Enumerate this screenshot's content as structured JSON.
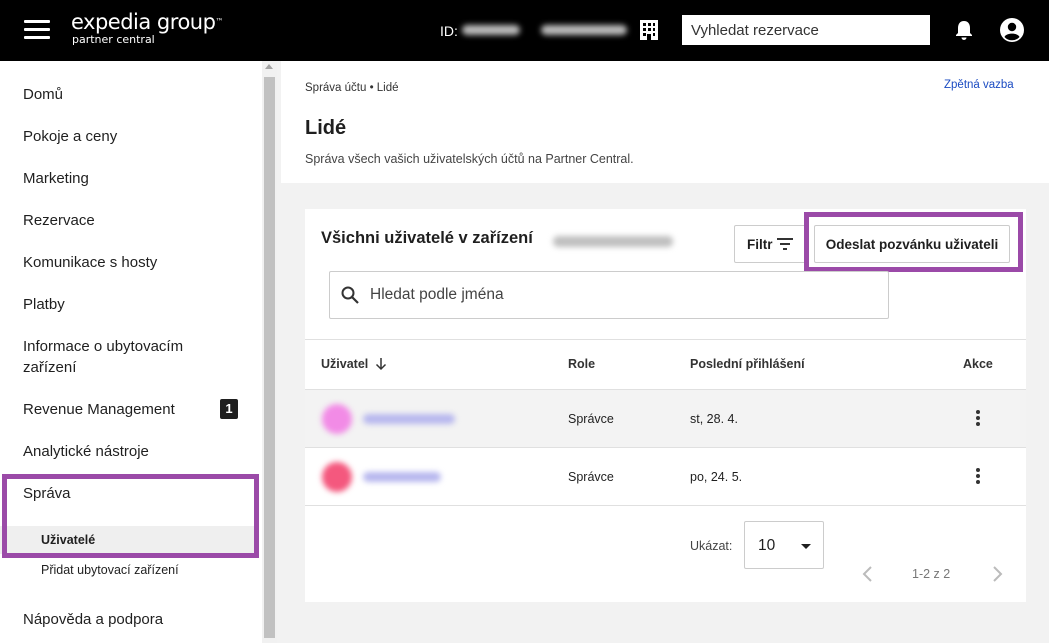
{
  "topbar": {
    "brand": "expedia group",
    "brand_tm": "™",
    "brand_sub": "partner central",
    "id_label": "ID:",
    "search_placeholder": "Vyhledat rezervace"
  },
  "sidebar": {
    "items": [
      {
        "label": "Domů"
      },
      {
        "label": "Pokoje a ceny"
      },
      {
        "label": "Marketing"
      },
      {
        "label": "Rezervace"
      },
      {
        "label": "Komunikace s hosty"
      },
      {
        "label": "Platby"
      },
      {
        "label": "Informace o ubytovacím zařízení"
      },
      {
        "label": "Revenue Management",
        "badge": "1"
      },
      {
        "label": "Analytické nástroje"
      },
      {
        "label": "Správa"
      },
      {
        "label": "Nápověda a podpora"
      }
    ],
    "sub_items": [
      {
        "label": "Uživatelé",
        "active": true
      },
      {
        "label": "Přidat ubytovací zařízení"
      }
    ]
  },
  "header": {
    "breadcrumb": "Správa účtu • Lidé",
    "feedback": "Zpětná vazba",
    "title": "Lidé",
    "description": "Správa všech vašich uživatelských účtů na Partner Central."
  },
  "card": {
    "title": "Všichni uživatelé v zařízení",
    "filter_label": "Filtr",
    "invite_label": "Odeslat pozvánku uživateli",
    "search_placeholder": "Hledat podle jména",
    "columns": [
      "Uživatel",
      "Role",
      "Poslední přihlášení",
      "Akce"
    ],
    "rows": [
      {
        "role": "Správce",
        "last_login": "st, 28. 4."
      },
      {
        "role": "Správce",
        "last_login": "po, 24. 5."
      }
    ],
    "show_label": "Ukázat:",
    "page_size": "10",
    "page_info": "1-2 z 2"
  },
  "colors": {
    "topbar": "#000000",
    "highlight": "#9b4aa8",
    "link": "#1a4bc2"
  }
}
